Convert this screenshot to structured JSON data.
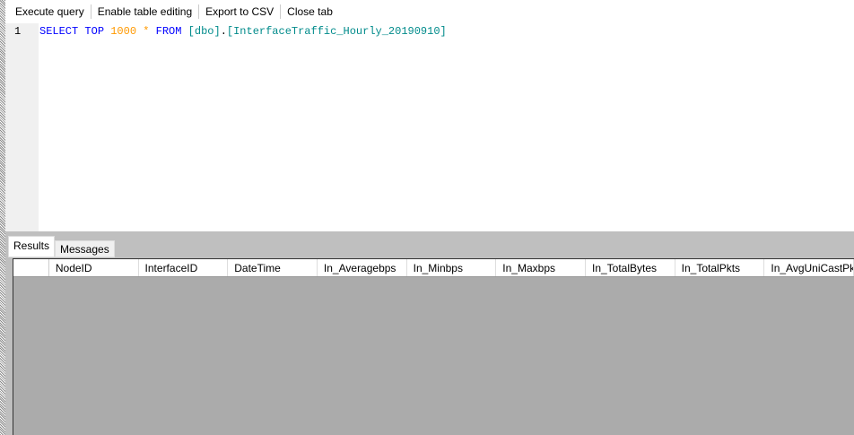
{
  "toolbar": {
    "items": [
      "Execute query",
      "Enable table editing",
      "Export to CSV",
      "Close tab"
    ]
  },
  "editor": {
    "line": "1",
    "tokens": {
      "select": "SELECT",
      "top": "TOP",
      "n": "1000",
      "star": "*",
      "from": "FROM",
      "schema": "[dbo]",
      "dot": ".",
      "table": "[InterfaceTraffic_Hourly_20190910]"
    }
  },
  "tabs": [
    "Results",
    "Messages"
  ],
  "columns": [
    "NodeID",
    "InterfaceID",
    "DateTime",
    "In_Averagebps",
    "In_Minbps",
    "In_Maxbps",
    "In_TotalBytes",
    "In_TotalPkts",
    "In_AvgUniCastPkts"
  ]
}
